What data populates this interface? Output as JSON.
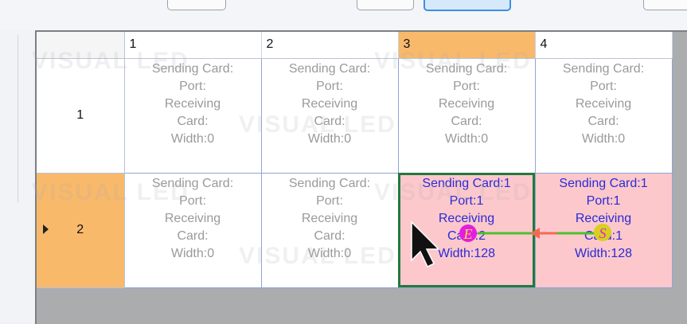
{
  "grid": {
    "columns": [
      "1",
      "2",
      "3",
      "4"
    ],
    "rows": [
      {
        "label": "1",
        "cells": [
          {
            "lines": [
              "Sending Card:",
              "Port:",
              "Receiving",
              "Card:",
              "Width:0"
            ]
          },
          {
            "lines": [
              "Sending Card:",
              "Port:",
              "Receiving",
              "Card:",
              "Width:0"
            ]
          },
          {
            "lines": [
              "Sending Card:",
              "Port:",
              "Receiving",
              "Card:",
              "Width:0"
            ]
          },
          {
            "lines": [
              "Sending Card:",
              "Port:",
              "Receiving",
              "Card:",
              "Width:0"
            ]
          }
        ]
      },
      {
        "label": "2",
        "cells": [
          {
            "lines": [
              "Sending Card:",
              "Port:",
              "Receiving",
              "Card:",
              "Width:0"
            ]
          },
          {
            "lines": [
              "Sending Card:",
              "Port:",
              "Receiving",
              "Card:",
              "Width:0"
            ]
          },
          {
            "lines": [
              "Sending Card:1",
              "Port:1",
              "Receiving",
              "Card:2",
              "Width:128"
            ]
          },
          {
            "lines": [
              "Sending Card:1",
              "Port:1",
              "Receiving",
              "Card:1",
              "Width:128"
            ]
          }
        ]
      }
    ]
  },
  "markers": {
    "end": "E",
    "start": "S"
  },
  "watermark": "VISUAL LED",
  "colors": {
    "header_selected": "#f8b96b",
    "assigned_cell": "#fcc8cc",
    "assigned_text": "#2a2bd6",
    "empty_text": "#9a9a9a",
    "active_border": "#237a3a",
    "arrow": "#4cc12b",
    "arrow_tail": "#f36a52",
    "marker_e": "#e21ee0",
    "marker_s": "#d8cf1e"
  }
}
